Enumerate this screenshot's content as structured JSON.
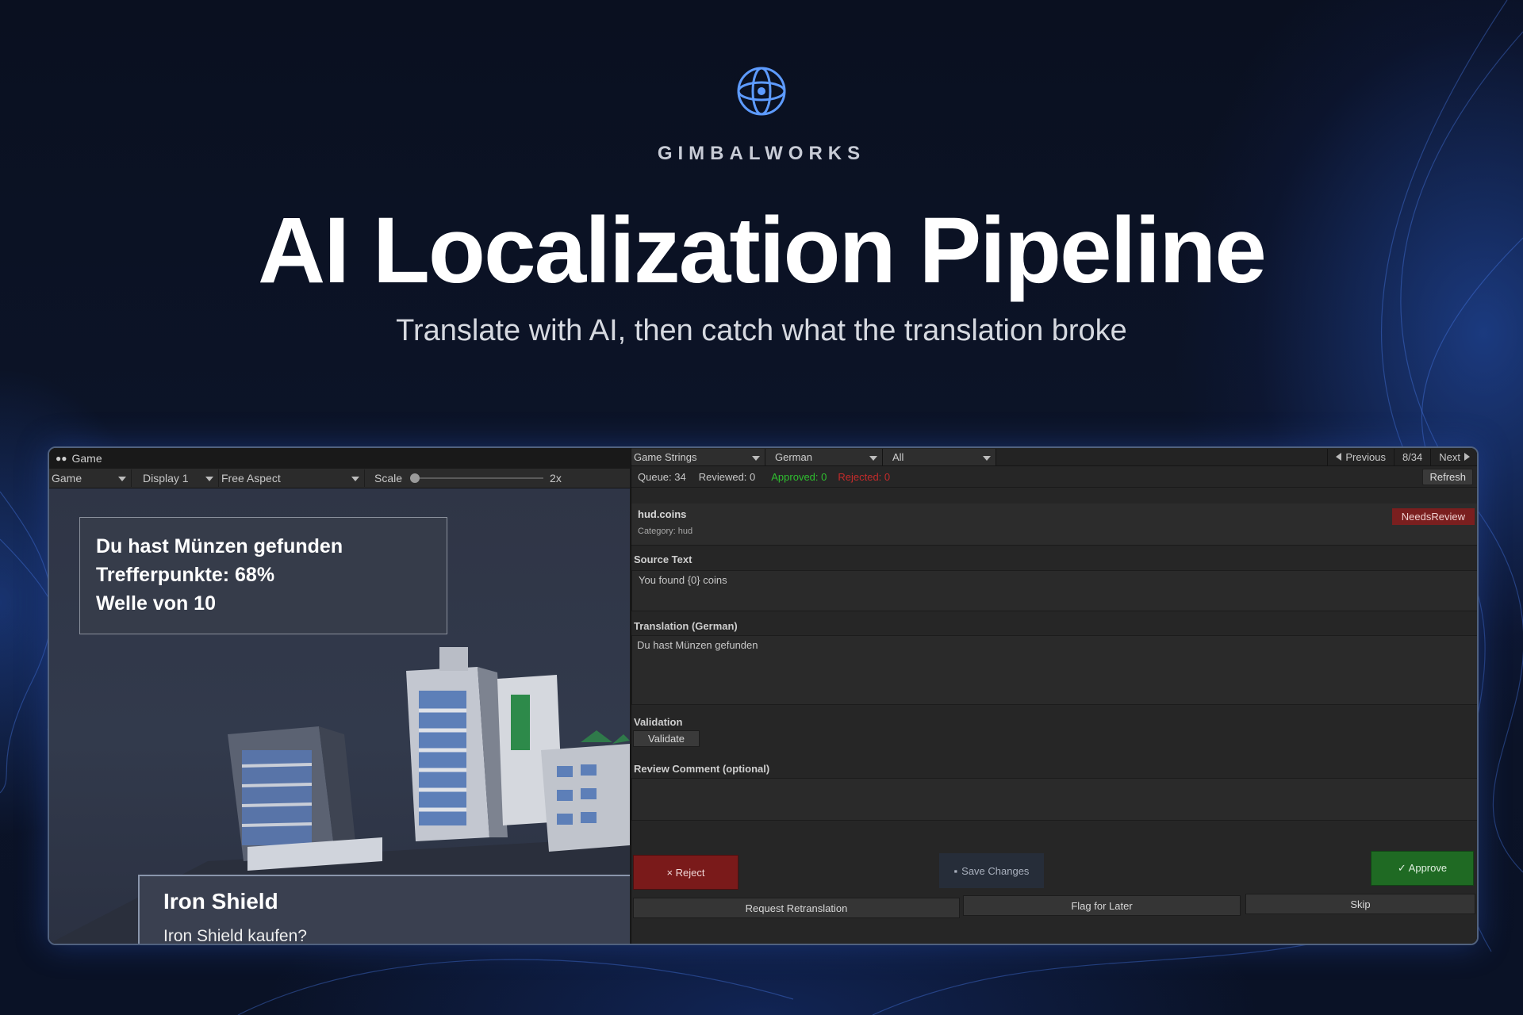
{
  "brand": {
    "name": "GIMBALWORKS",
    "logo_icon": "gimbal-logo-icon",
    "accent": "#5d9bff"
  },
  "hero": {
    "title": "AI Localization Pipeline",
    "subtitle": "Translate with AI, then catch what the translation broke"
  },
  "game_view": {
    "tab_label": "Game",
    "toolbar": {
      "mode": "Game",
      "display": "Display 1",
      "aspect": "Free Aspect",
      "scale_label": "Scale",
      "scale_value": "2x"
    },
    "hud_lines": [
      "Du hast Münzen gefunden",
      "Trefferpunkte: 68%",
      "Welle von 10"
    ],
    "shop": {
      "title": "Iron Shield",
      "prompt": "Iron Shield kaufen?"
    }
  },
  "review": {
    "table_select": "Game Strings",
    "language_select": "German",
    "filter_select": "All",
    "nav": {
      "previous": "Previous",
      "position": "8/34",
      "next": "Next"
    },
    "stats": {
      "queue": "Queue: 34",
      "reviewed": "Reviewed: 0",
      "approved": "Approved: 0",
      "rejected": "Rejected: 0"
    },
    "colors": {
      "approved": "#2fbf2f",
      "rejected": "#c42b2b"
    },
    "refresh_label": "Refresh",
    "entry": {
      "key": "hud.coins",
      "category": "Category: hud",
      "status": "NeedsReview"
    },
    "source_label": "Source Text",
    "source_text": "You found {0} coins",
    "translation_label": "Translation (German)",
    "translation_text": "Du hast Münzen gefunden",
    "validation_label": "Validation",
    "validate_button": "Validate",
    "comment_label": "Review Comment (optional)",
    "comment_text": "",
    "buttons": {
      "reject": "× Reject",
      "save": "Save Changes",
      "approve": "✓ Approve",
      "retranslate": "Request Retranslation",
      "flag": "Flag for Later",
      "skip": "Skip"
    }
  }
}
